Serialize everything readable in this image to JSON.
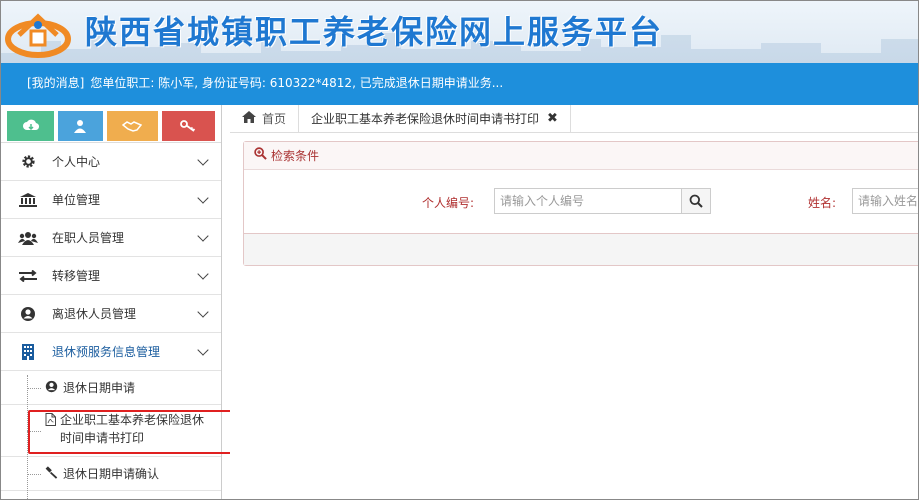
{
  "header": {
    "site_title": "陕西省城镇职工养老保险网上服务平台"
  },
  "notice": {
    "tag": "[我的消息]",
    "text": "您单位职工: 陈小军, 身份证号码: 610322*4812, 已完成退休日期申请业务..."
  },
  "sidebar": {
    "shortcut_icons": [
      "cloud-download-icon",
      "user-icon",
      "handshake-icon",
      "key-icon"
    ],
    "menu": [
      {
        "label": "个人中心",
        "icon": "gear-icon"
      },
      {
        "label": "单位管理",
        "icon": "bank-icon"
      },
      {
        "label": "在职人员管理",
        "icon": "users-icon"
      },
      {
        "label": "转移管理",
        "icon": "exchange-icon"
      },
      {
        "label": "离退休人员管理",
        "icon": "user-circle-icon"
      },
      {
        "label": "退休预服务信息管理",
        "icon": "building-icon"
      }
    ],
    "sub_items": [
      {
        "label": "退休日期申请",
        "icon": "user-circle-icon"
      },
      {
        "label": "企业职工基本养老保险退休时间申请书打印",
        "icon": "pdf-file-icon"
      },
      {
        "label": "退休日期申请确认",
        "icon": "gavel-icon"
      }
    ]
  },
  "tabs": {
    "home": "首页",
    "current": "企业职工基本养老保险退休时间申请书打印"
  },
  "search_panel": {
    "title": "检索条件",
    "person_id_label": "个人编号:",
    "person_id_placeholder": "请输入个人编号",
    "name_label": "姓名:",
    "name_placeholder": "请输入姓名"
  },
  "colors": {
    "brand_blue": "#1f78d1",
    "notice_bg": "#1e8fdc",
    "highlight_red": "#e02020"
  }
}
